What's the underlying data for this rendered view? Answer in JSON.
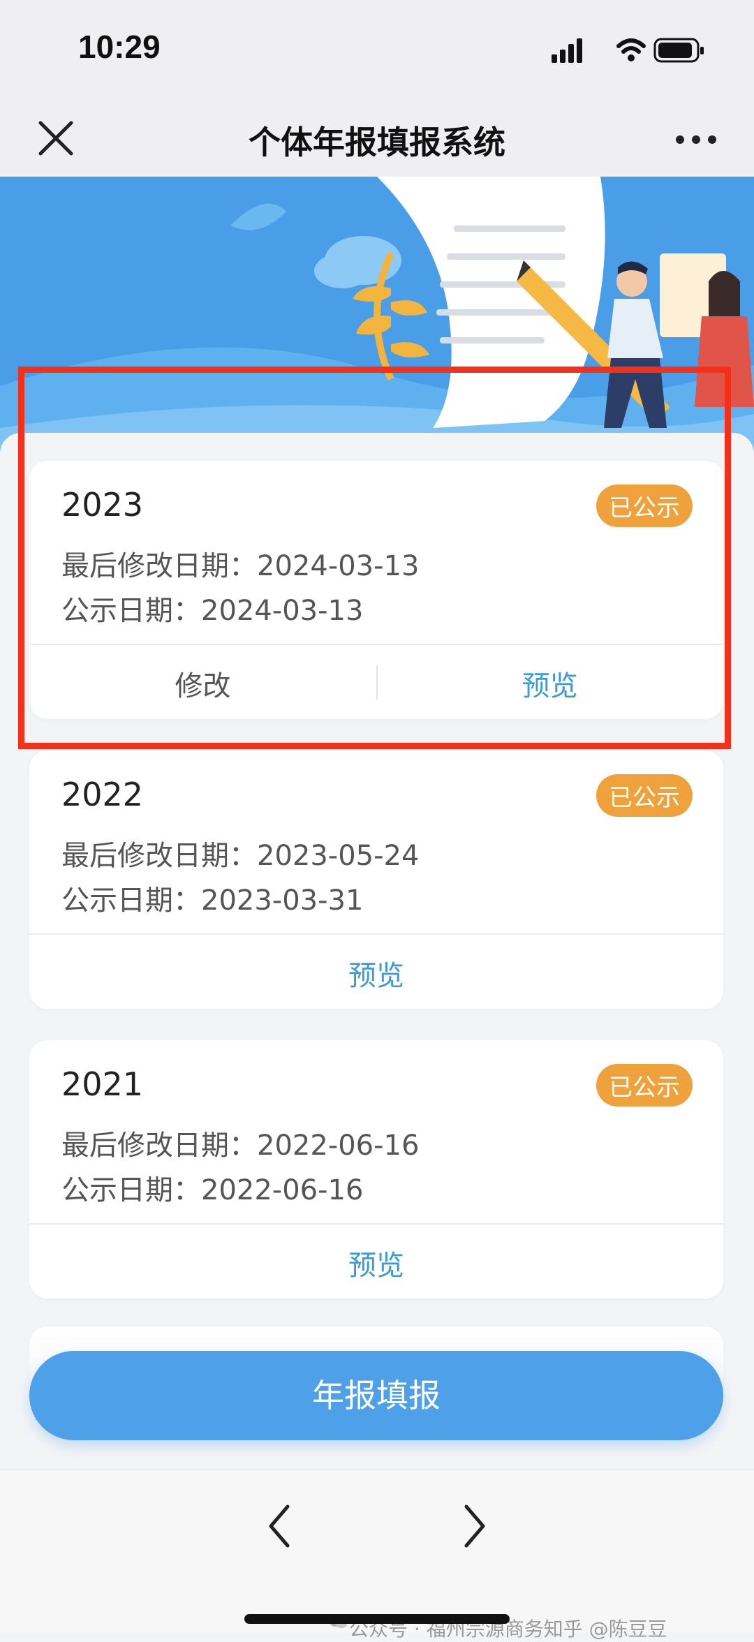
{
  "status_bar": {
    "time": "10:29"
  },
  "nav": {
    "title": "个体年报填报系统"
  },
  "records": [
    {
      "year": "2023",
      "badge": "已公示",
      "last_modified": "最后修改日期：2024-03-13",
      "publish_date": "公示日期：2024-03-13",
      "actions": [
        "修改",
        "预览"
      ]
    },
    {
      "year": "2022",
      "badge": "已公示",
      "last_modified": "最后修改日期：2023-05-24",
      "publish_date": "公示日期：2023-03-31",
      "actions": [
        "预览"
      ]
    },
    {
      "year": "2021",
      "badge": "已公示",
      "last_modified": "最后修改日期：2022-06-16",
      "publish_date": "公示日期：2022-06-16",
      "actions": [
        "预览"
      ]
    }
  ],
  "main_button": {
    "label": "年报填报"
  },
  "watermark": {
    "text": "公众号 · 福州宗源商务知乎 @陈豆豆"
  },
  "colors": {
    "accent": "#4ea1e8",
    "badge": "#efa13b",
    "highlight": "#f4301b",
    "link": "#3a9bd8"
  }
}
